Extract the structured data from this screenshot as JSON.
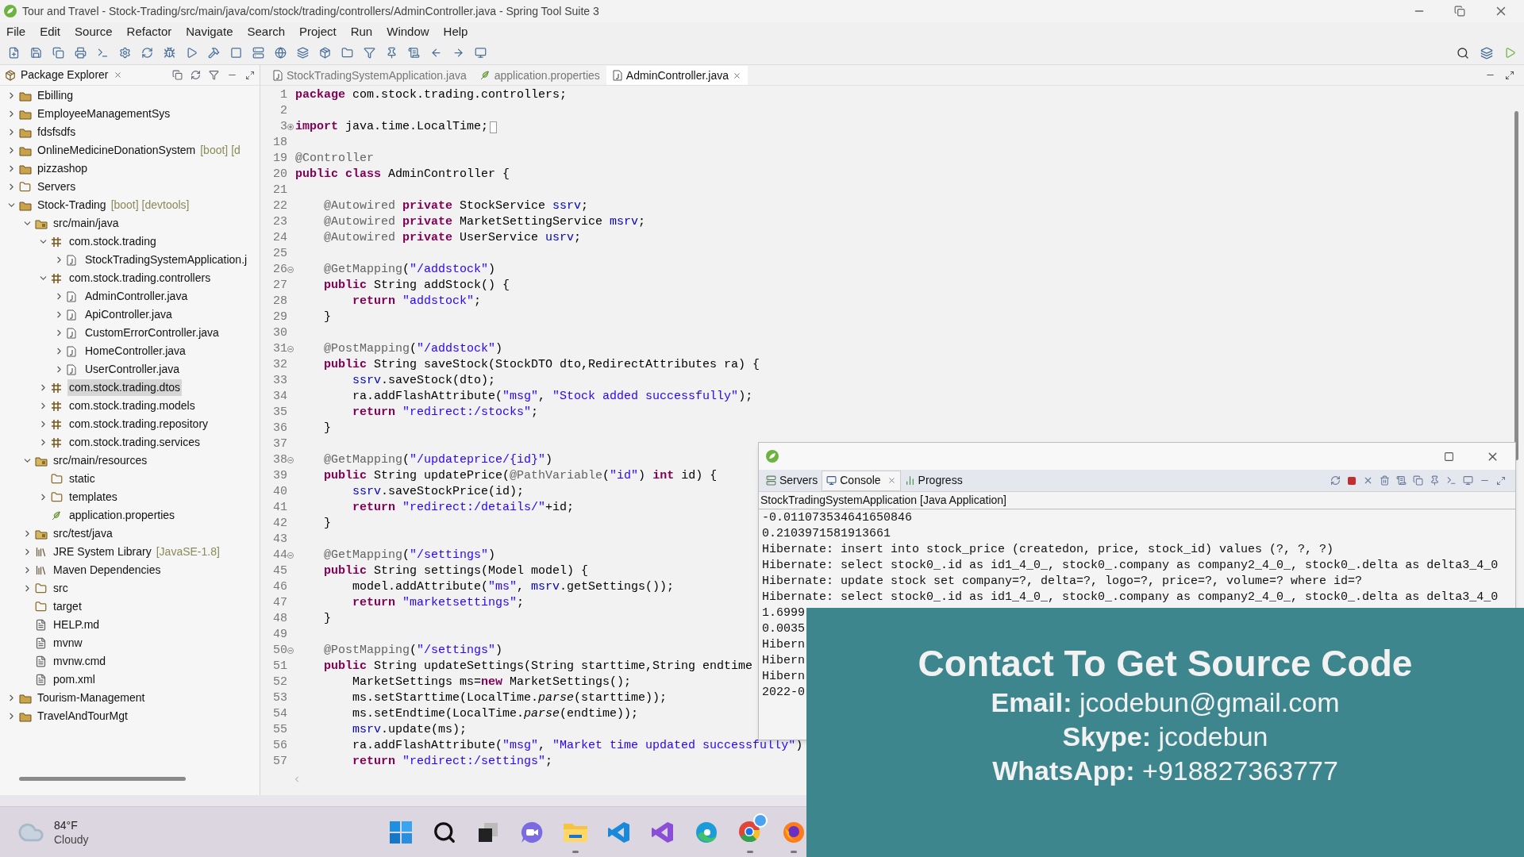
{
  "window": {
    "title": "Tour and Travel - Stock-Trading/src/main/java/com/stock/trading/controllers/AdminController.java - Spring Tool Suite 3"
  },
  "menu": [
    "File",
    "Edit",
    "Source",
    "Refactor",
    "Navigate",
    "Search",
    "Project",
    "Run",
    "Window",
    "Help"
  ],
  "package_explorer": {
    "title": "Package Explorer",
    "tree": [
      {
        "label": "Ebilling",
        "kind": "project",
        "expandable": true,
        "expanded": false,
        "selected": false
      },
      {
        "label": "EmployeeManagementSys",
        "kind": "project",
        "expandable": true,
        "expanded": false,
        "selected": false
      },
      {
        "label": "fdsfsdfs",
        "kind": "project",
        "expandable": true,
        "expanded": false,
        "selected": false
      },
      {
        "label": "OnlineMedicineDonationSystem",
        "decoration": "[boot] [d",
        "kind": "project",
        "expandable": true,
        "expanded": false,
        "selected": false
      },
      {
        "label": "pizzashop",
        "kind": "project",
        "expandable": true,
        "expanded": false,
        "selected": false
      },
      {
        "label": "Servers",
        "kind": "folder",
        "expandable": true,
        "expanded": false,
        "selected": false
      },
      {
        "label": "Stock-Trading",
        "decoration": "[boot] [devtools]",
        "kind": "project",
        "expandable": true,
        "expanded": true,
        "selected": false,
        "children": [
          {
            "label": "src/main/java",
            "kind": "source",
            "expandable": true,
            "expanded": true,
            "selected": false,
            "children": [
              {
                "label": "com.stock.trading",
                "kind": "package",
                "expandable": true,
                "expanded": true,
                "selected": false,
                "children": [
                  {
                    "label": "StockTradingSystemApplication.j",
                    "kind": "java",
                    "expandable": true,
                    "expanded": false,
                    "selected": false
                  }
                ]
              },
              {
                "label": "com.stock.trading.controllers",
                "kind": "package",
                "expandable": true,
                "expanded": true,
                "selected": false,
                "children": [
                  {
                    "label": "AdminController.java",
                    "kind": "java",
                    "expandable": true,
                    "expanded": false,
                    "selected": false
                  },
                  {
                    "label": "ApiController.java",
                    "kind": "java",
                    "expandable": true,
                    "expanded": false,
                    "selected": false
                  },
                  {
                    "label": "CustomErrorController.java",
                    "kind": "java",
                    "expandable": true,
                    "expanded": false,
                    "selected": false
                  },
                  {
                    "label": "HomeController.java",
                    "kind": "java",
                    "expandable": true,
                    "expanded": false,
                    "selected": false
                  },
                  {
                    "label": "UserController.java",
                    "kind": "java",
                    "expandable": true,
                    "expanded": false,
                    "selected": false
                  }
                ]
              },
              {
                "label": "com.stock.trading.dtos",
                "kind": "package",
                "expandable": true,
                "expanded": false,
                "selected": true
              },
              {
                "label": "com.stock.trading.models",
                "kind": "package",
                "expandable": true,
                "expanded": false,
                "selected": false
              },
              {
                "label": "com.stock.trading.repository",
                "kind": "package",
                "expandable": true,
                "expanded": false,
                "selected": false
              },
              {
                "label": "com.stock.trading.services",
                "kind": "package",
                "expandable": true,
                "expanded": false,
                "selected": false
              }
            ]
          },
          {
            "label": "src/main/resources",
            "kind": "source",
            "expandable": true,
            "expanded": true,
            "selected": false,
            "children": [
              {
                "label": "static",
                "kind": "folder",
                "expandable": false,
                "selected": false
              },
              {
                "label": "templates",
                "kind": "folder",
                "expandable": true,
                "expanded": false,
                "selected": false
              },
              {
                "label": "application.properties",
                "kind": "properties",
                "expandable": false,
                "selected": false
              }
            ]
          },
          {
            "label": "src/test/java",
            "kind": "source",
            "expandable": true,
            "expanded": false,
            "selected": false
          },
          {
            "label": "JRE System Library",
            "decoration": "[JavaSE-1.8]",
            "kind": "library",
            "expandable": true,
            "expanded": false,
            "selected": false
          },
          {
            "label": "Maven Dependencies",
            "kind": "library",
            "expandable": true,
            "expanded": false,
            "selected": false
          },
          {
            "label": "src",
            "kind": "folder",
            "expandable": true,
            "expanded": false,
            "selected": false
          },
          {
            "label": "target",
            "kind": "folder",
            "expandable": false,
            "selected": false
          },
          {
            "label": "HELP.md",
            "kind": "file",
            "expandable": false,
            "selected": false
          },
          {
            "label": "mvnw",
            "kind": "file",
            "expandable": false,
            "selected": false
          },
          {
            "label": "mvnw.cmd",
            "kind": "file",
            "expandable": false,
            "selected": false
          },
          {
            "label": "pom.xml",
            "kind": "file",
            "expandable": false,
            "selected": false
          }
        ]
      },
      {
        "label": "Tourism-Management",
        "kind": "project",
        "expandable": true,
        "expanded": false,
        "selected": false
      },
      {
        "label": "TravelAndTourMgt",
        "kind": "project",
        "expandable": true,
        "expanded": false,
        "selected": false
      }
    ]
  },
  "editor": {
    "tabs": [
      {
        "label": "StockTradingSystemApplication.java",
        "kind": "java",
        "selected": false
      },
      {
        "label": "application.properties",
        "kind": "properties",
        "selected": false
      },
      {
        "label": "AdminController.java",
        "kind": "java",
        "selected": true
      }
    ],
    "lines": [
      {
        "number": "1",
        "foldable": false,
        "folded": false,
        "tokens": [
          {
            "kind": "kw",
            "text": "package"
          },
          {
            "kind": "plain",
            "text": " com.stock.trading.controllers;"
          }
        ]
      },
      {
        "number": "2",
        "foldable": false,
        "folded": false
      },
      {
        "number": "3",
        "foldable": true,
        "folded": true,
        "tokens": [
          {
            "kind": "kw",
            "text": "import"
          },
          {
            "kind": "plain",
            "text": " java.time.LocalTime;"
          }
        ]
      },
      {
        "number": "18",
        "foldable": false,
        "folded": false
      },
      {
        "number": "19",
        "foldable": false,
        "folded": false,
        "tokens": [
          {
            "kind": "ann",
            "text": "@Controller"
          }
        ]
      },
      {
        "number": "20",
        "foldable": false,
        "folded": false,
        "tokens": [
          {
            "kind": "kw",
            "text": "public class"
          },
          {
            "kind": "plain",
            "text": " AdminController {"
          }
        ]
      },
      {
        "number": "21",
        "foldable": false,
        "folded": false
      },
      {
        "number": "22",
        "foldable": false,
        "folded": false,
        "tokens": [
          {
            "kind": "ann",
            "text": "    @Autowired "
          },
          {
            "kind": "kw",
            "text": "private"
          },
          {
            "kind": "plain",
            "text": " StockService "
          },
          {
            "kind": "field",
            "text": "ssrv"
          },
          {
            "kind": "plain",
            "text": ";"
          }
        ]
      },
      {
        "number": "23",
        "foldable": false,
        "folded": false,
        "tokens": [
          {
            "kind": "ann",
            "text": "    @Autowired "
          },
          {
            "kind": "kw",
            "text": "private"
          },
          {
            "kind": "plain",
            "text": " MarketSettingService "
          },
          {
            "kind": "field",
            "text": "msrv"
          },
          {
            "kind": "plain",
            "text": ";"
          }
        ]
      },
      {
        "number": "24",
        "foldable": false,
        "folded": false,
        "tokens": [
          {
            "kind": "ann",
            "text": "    @Autowired "
          },
          {
            "kind": "kw",
            "text": "private"
          },
          {
            "kind": "plain",
            "text": " UserService "
          },
          {
            "kind": "field",
            "text": "usrv"
          },
          {
            "kind": "plain",
            "text": ";"
          }
        ]
      },
      {
        "number": "25",
        "foldable": false,
        "folded": false
      },
      {
        "number": "26",
        "foldable": true,
        "folded": false,
        "tokens": [
          {
            "kind": "ann",
            "text": "    @GetMapping"
          },
          {
            "kind": "plain",
            "text": "("
          },
          {
            "kind": "str",
            "text": "\"/addstock\""
          },
          {
            "kind": "plain",
            "text": ")"
          }
        ]
      },
      {
        "number": "27",
        "foldable": false,
        "folded": false,
        "tokens": [
          {
            "kind": "kw",
            "text": "    public"
          },
          {
            "kind": "plain",
            "text": " String addStock() {"
          }
        ]
      },
      {
        "number": "28",
        "foldable": false,
        "folded": false,
        "tokens": [
          {
            "kind": "kw",
            "text": "        return"
          },
          {
            "kind": "str",
            "text": " \"addstock\""
          },
          {
            "kind": "plain",
            "text": ";"
          }
        ]
      },
      {
        "number": "29",
        "foldable": false,
        "folded": false,
        "tokens": [
          {
            "kind": "plain",
            "text": "    }"
          }
        ]
      },
      {
        "number": "30",
        "foldable": false,
        "folded": false
      },
      {
        "number": "31",
        "foldable": true,
        "folded": false,
        "tokens": [
          {
            "kind": "ann",
            "text": "    @PostMapping"
          },
          {
            "kind": "plain",
            "text": "("
          },
          {
            "kind": "str",
            "text": "\"/addstock\""
          },
          {
            "kind": "plain",
            "text": ")"
          }
        ]
      },
      {
        "number": "32",
        "foldable": false,
        "folded": false,
        "tokens": [
          {
            "kind": "kw",
            "text": "    public"
          },
          {
            "kind": "plain",
            "text": " String saveStock(StockDTO dto,RedirectAttributes ra) {"
          }
        ]
      },
      {
        "number": "33",
        "foldable": false,
        "folded": false,
        "tokens": [
          {
            "kind": "field",
            "text": "        ssrv"
          },
          {
            "kind": "plain",
            "text": ".saveStock(dto);"
          }
        ]
      },
      {
        "number": "34",
        "foldable": false,
        "folded": false,
        "tokens": [
          {
            "kind": "plain",
            "text": "        ra.addFlashAttribute("
          },
          {
            "kind": "str",
            "text": "\"msg\""
          },
          {
            "kind": "plain",
            "text": ", "
          },
          {
            "kind": "str",
            "text": "\"Stock added successfully\""
          },
          {
            "kind": "plain",
            "text": ");"
          }
        ]
      },
      {
        "number": "35",
        "foldable": false,
        "folded": false,
        "tokens": [
          {
            "kind": "kw",
            "text": "        return"
          },
          {
            "kind": "str",
            "text": " \"redirect:/stocks\""
          },
          {
            "kind": "plain",
            "text": ";"
          }
        ]
      },
      {
        "number": "36",
        "foldable": false,
        "folded": false,
        "tokens": [
          {
            "kind": "plain",
            "text": "    }"
          }
        ]
      },
      {
        "number": "37",
        "foldable": false,
        "folded": false
      },
      {
        "number": "38",
        "foldable": true,
        "folded": false,
        "tokens": [
          {
            "kind": "ann",
            "text": "    @GetMapping"
          },
          {
            "kind": "plain",
            "text": "("
          },
          {
            "kind": "str",
            "text": "\"/updateprice/{id}\""
          },
          {
            "kind": "plain",
            "text": ")"
          }
        ]
      },
      {
        "number": "39",
        "foldable": false,
        "folded": false,
        "tokens": [
          {
            "kind": "kw",
            "text": "    public"
          },
          {
            "kind": "plain",
            "text": " String updatePrice("
          },
          {
            "kind": "ann",
            "text": "@PathVariable"
          },
          {
            "kind": "plain",
            "text": "("
          },
          {
            "kind": "str",
            "text": "\"id\""
          },
          {
            "kind": "plain",
            "text": ") "
          },
          {
            "kind": "kw",
            "text": "int"
          },
          {
            "kind": "plain",
            "text": " id) {"
          }
        ]
      },
      {
        "number": "40",
        "foldable": false,
        "folded": false,
        "tokens": [
          {
            "kind": "field",
            "text": "        ssrv"
          },
          {
            "kind": "plain",
            "text": ".saveStockPrice(id);"
          }
        ]
      },
      {
        "number": "41",
        "foldable": false,
        "folded": false,
        "tokens": [
          {
            "kind": "kw",
            "text": "        return"
          },
          {
            "kind": "str",
            "text": " \"redirect:/details/\""
          },
          {
            "kind": "plain",
            "text": "+id;"
          }
        ]
      },
      {
        "number": "42",
        "foldable": false,
        "folded": false,
        "tokens": [
          {
            "kind": "plain",
            "text": "    }"
          }
        ]
      },
      {
        "number": "43",
        "foldable": false,
        "folded": false
      },
      {
        "number": "44",
        "foldable": true,
        "folded": false,
        "tokens": [
          {
            "kind": "ann",
            "text": "    @GetMapping"
          },
          {
            "kind": "plain",
            "text": "("
          },
          {
            "kind": "str",
            "text": "\"/settings\""
          },
          {
            "kind": "plain",
            "text": ")"
          }
        ]
      },
      {
        "number": "45",
        "foldable": false,
        "folded": false,
        "tokens": [
          {
            "kind": "kw",
            "text": "    public"
          },
          {
            "kind": "plain",
            "text": " String settings(Model model) {"
          }
        ]
      },
      {
        "number": "46",
        "foldable": false,
        "folded": false,
        "tokens": [
          {
            "kind": "plain",
            "text": "        model.addAttribute("
          },
          {
            "kind": "str",
            "text": "\"ms\""
          },
          {
            "kind": "plain",
            "text": ", "
          },
          {
            "kind": "field",
            "text": "msrv"
          },
          {
            "kind": "plain",
            "text": ".getSettings());"
          }
        ]
      },
      {
        "number": "47",
        "foldable": false,
        "folded": false,
        "tokens": [
          {
            "kind": "kw",
            "text": "        return"
          },
          {
            "kind": "str",
            "text": " \"marketsettings\""
          },
          {
            "kind": "plain",
            "text": ";"
          }
        ]
      },
      {
        "number": "48",
        "foldable": false,
        "folded": false,
        "tokens": [
          {
            "kind": "plain",
            "text": "    }"
          }
        ]
      },
      {
        "number": "49",
        "foldable": false,
        "folded": false
      },
      {
        "number": "50",
        "foldable": true,
        "folded": false,
        "tokens": [
          {
            "kind": "ann",
            "text": "    @PostMapping"
          },
          {
            "kind": "plain",
            "text": "("
          },
          {
            "kind": "str",
            "text": "\"/settings\""
          },
          {
            "kind": "plain",
            "text": ")"
          }
        ]
      },
      {
        "number": "51",
        "foldable": false,
        "folded": false,
        "tokens": [
          {
            "kind": "kw",
            "text": "    public"
          },
          {
            "kind": "plain",
            "text": " String updateSettings(String starttime,String endtime"
          }
        ]
      },
      {
        "number": "52",
        "foldable": false,
        "folded": false,
        "tokens": [
          {
            "kind": "plain",
            "text": "        MarketSettings ms="
          },
          {
            "kind": "kw",
            "text": "new"
          },
          {
            "kind": "plain",
            "text": " MarketSettings();"
          }
        ]
      },
      {
        "number": "53",
        "foldable": false,
        "folded": false,
        "tokens": [
          {
            "kind": "plain",
            "text": "        ms.setStarttime(LocalTime."
          },
          {
            "kind": "italic",
            "text": "parse"
          },
          {
            "kind": "plain",
            "text": "(starttime));"
          }
        ]
      },
      {
        "number": "54",
        "foldable": false,
        "folded": false,
        "tokens": [
          {
            "kind": "plain",
            "text": "        ms.setEndtime(LocalTime."
          },
          {
            "kind": "italic",
            "text": "parse"
          },
          {
            "kind": "plain",
            "text": "(endtime));"
          }
        ]
      },
      {
        "number": "55",
        "foldable": false,
        "folded": false,
        "tokens": [
          {
            "kind": "field",
            "text": "        msrv"
          },
          {
            "kind": "plain",
            "text": ".update(ms);"
          }
        ]
      },
      {
        "number": "56",
        "foldable": false,
        "folded": false,
        "tokens": [
          {
            "kind": "plain",
            "text": "        ra.addFlashAttribute("
          },
          {
            "kind": "str",
            "text": "\"msg\""
          },
          {
            "kind": "plain",
            "text": ", "
          },
          {
            "kind": "str",
            "text": "\"Market time updated successfully\""
          },
          {
            "kind": "plain",
            "text": ")"
          }
        ]
      },
      {
        "number": "57",
        "foldable": false,
        "folded": false,
        "tokens": [
          {
            "kind": "kw",
            "text": "        return"
          },
          {
            "kind": "str",
            "text": " \"redirect:/settings\""
          },
          {
            "kind": "plain",
            "text": ";"
          }
        ]
      }
    ]
  },
  "console_window": {
    "tabs": [
      {
        "label": "Servers",
        "kind": "servers",
        "selected": false
      },
      {
        "label": "Console",
        "kind": "console",
        "selected": true
      },
      {
        "label": "Progress",
        "kind": "progress",
        "selected": false
      }
    ],
    "process": "StockTradingSystemApplication [Java Application]",
    "lines": [
      "-0.011073534641650846",
      "0.2103971581913661",
      "Hibernate: insert into stock_price (createdon, price, stock_id) values (?, ?, ?)",
      "Hibernate: select stock0_.id as id1_4_0_, stock0_.company as company2_4_0_, stock0_.delta as delta3_4_0",
      "Hibernate: update stock set company=?, delta=?, logo=?, price=?, volume=? where id=?",
      "Hibernate: select stock0_.id as id1_4_0_, stock0_.company as company2_4_0_, stock0_.delta as delta3_4_0",
      "1.6999",
      "0.0035",
      "Hibern",
      "Hibern",
      "Hibern",
      "2022-0"
    ]
  },
  "contact_banner": {
    "heading": "Contact To Get Source Code",
    "lines": [
      "**Email:** jcodebun@gmail.com",
      "**Skype:** jcodebun",
      "**WhatsApp:** +918827363777"
    ]
  },
  "taskbar": {
    "weather": {
      "temperature": "84°F",
      "condition": "Cloudy"
    },
    "apps": [
      {
        "kind": "start",
        "running": false
      },
      {
        "kind": "search",
        "running": false
      },
      {
        "kind": "taskview",
        "running": false
      },
      {
        "kind": "chat",
        "running": false
      },
      {
        "kind": "explorer",
        "running": true
      },
      {
        "kind": "vscode",
        "running": false
      },
      {
        "kind": "studio",
        "running": false
      },
      {
        "kind": "edge",
        "running": false
      },
      {
        "kind": "chrome",
        "running": true
      },
      {
        "kind": "firefox",
        "running": true
      }
    ]
  }
}
